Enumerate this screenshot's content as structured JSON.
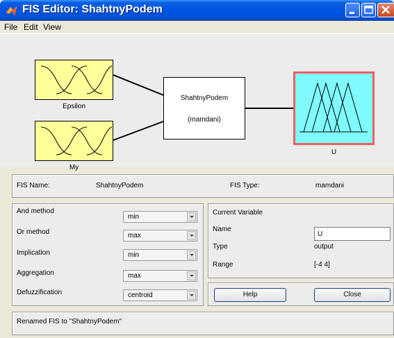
{
  "window": {
    "title": "FIS Editor: ShahtnyPodem"
  },
  "menu": {
    "items": [
      "File",
      "Edit",
      "View"
    ]
  },
  "diagram": {
    "inputs": [
      "Epsilon",
      "My"
    ],
    "fis_name": "ShahtnyPodem",
    "fis_type": "(mamdani)",
    "output": "U"
  },
  "fis_info": {
    "name_label": "FIS Name:",
    "name_value": "ShahtnyPodem",
    "type_label": "FIS Type:",
    "type_value": "mamdani"
  },
  "methods": [
    {
      "label": "And method",
      "value": "min"
    },
    {
      "label": "Or method",
      "value": "max"
    },
    {
      "label": "Implication",
      "value": "min"
    },
    {
      "label": "Aggregation",
      "value": "max"
    },
    {
      "label": "Defuzzification",
      "value": "centroid"
    }
  ],
  "current_variable": {
    "title": "Current Variable",
    "name_label": "Name",
    "name_value": "U",
    "type_label": "Type",
    "type_value": "output",
    "range_label": "Range",
    "range_value": "[-4 4]"
  },
  "buttons": {
    "help": "Help",
    "close": "Close"
  },
  "status": {
    "text": "Renamed FIS to \"ShahtnyPodem\""
  }
}
